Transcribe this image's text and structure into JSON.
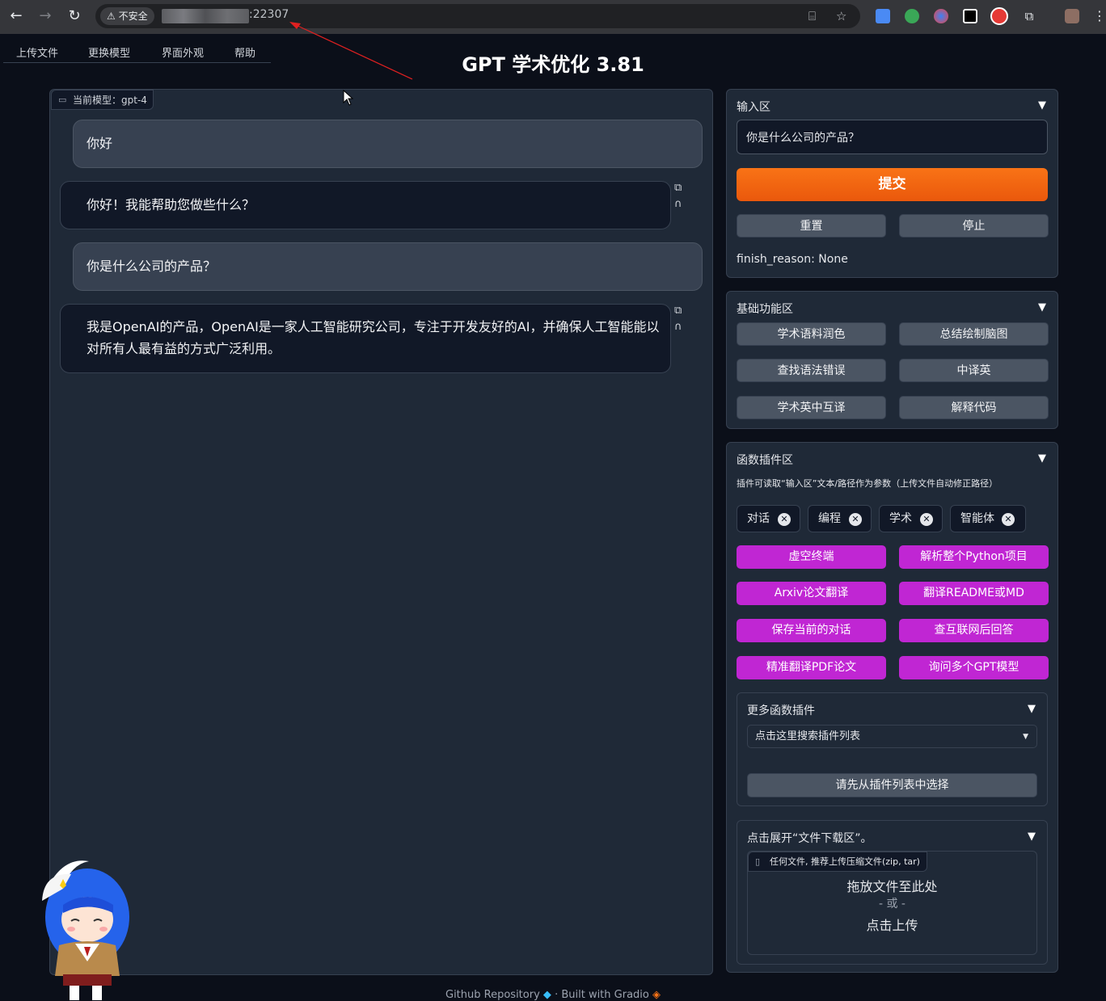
{
  "browser": {
    "insecure_label": "不安全",
    "port": ":22307"
  },
  "menu": [
    "上传文件",
    "更换模型",
    "界面外观",
    "帮助"
  ],
  "title": "GPT 学术优化 3.81",
  "chat": {
    "model_label": "当前模型：gpt-4",
    "messages": [
      {
        "role": "user",
        "text": "你好"
      },
      {
        "role": "bot",
        "text": "你好！我能帮助您做些什么？"
      },
      {
        "role": "user",
        "text": "你是什么公司的产品？"
      },
      {
        "role": "bot",
        "line1": "我是OpenAI的产品，OpenAI是一家人工智能研究公司，专注于开发友好的AI，并确保人工智能能以",
        "line2": "对所有人最有益的方式广泛利用。"
      }
    ]
  },
  "input_panel": {
    "title": "输入区",
    "value": "你是什么公司的产品？",
    "submit": "提交",
    "reset": "重置",
    "stop": "停止",
    "status": "finish_reason: None"
  },
  "basic_panel": {
    "title": "基础功能区",
    "buttons": [
      "学术语料润色",
      "总结绘制脑图",
      "查找语法错误",
      "中译英",
      "学术英中互译",
      "解释代码"
    ]
  },
  "plugin_panel": {
    "title": "函数插件区",
    "hint": "插件可读取“输入区”文本/路径作为参数（上传文件自动修正路径）",
    "chips": [
      "对话",
      "编程",
      "学术",
      "智能体"
    ],
    "buttons": [
      "虚空终端",
      "解析整个Python项目",
      "Arxiv论文翻译",
      "翻译README或MD",
      "保存当前的对话",
      "查互联网后回答",
      "精准翻译PDF论文",
      "询问多个GPT模型"
    ]
  },
  "more_plugins": {
    "title": "更多函数插件",
    "dropdown": "点击这里搜索插件列表",
    "button": "请先从插件列表中选择"
  },
  "download_panel": {
    "title": "点击展开“文件下载区”。",
    "tag": "任何文件, 推荐上传压缩文件(zip, tar)",
    "drop": "拖放文件至此处",
    "or": "- 或 -",
    "click": "点击上传"
  },
  "footer": {
    "repo": "Github Repository",
    "built": "Built with Gradio"
  },
  "colors": {
    "accent_orange": "#f97316",
    "plugin_purple": "#c026d3",
    "background": "#0b0f19",
    "panel": "#1f2937"
  }
}
